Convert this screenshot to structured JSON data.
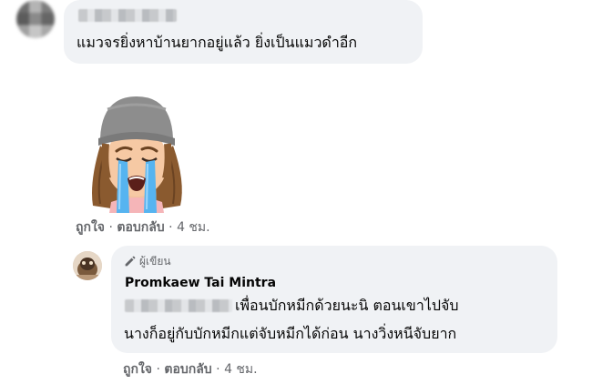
{
  "comment1": {
    "text": "แมวจรยิ่งหาบ้านยากอยู่แล้ว ยิ่งเป็นแมวดำอีก",
    "actions": {
      "like": "ถูกใจ",
      "reply": "ตอบกลับ",
      "separator": "·",
      "time": "4 ชม."
    }
  },
  "comment2": {
    "badge": "ผู้เขียน",
    "author": "Promkaew Tai Mintra",
    "line1": "เพื่อนบักหมีกด้วยนะนิ ตอนเขาไปจับ",
    "line2": "นางก็อยู่กับบักหมีกแต่จับหมีกได้ก่อน นางวิ่งหนีจับยาก",
    "actions": {
      "like": "ถูกใจ",
      "reply": "ตอบกลับ",
      "separator": "·",
      "time": "4 ชม."
    }
  },
  "icons": {
    "pencil": "pencil-icon",
    "sticker": "crying-avatar-sticker"
  },
  "colors": {
    "bubble": "#f0f2f5",
    "meta": "#65676b",
    "text": "#050505"
  }
}
